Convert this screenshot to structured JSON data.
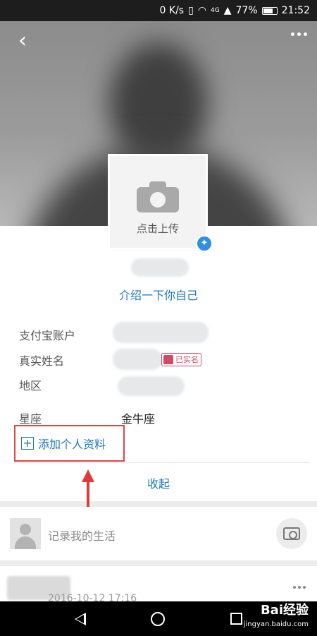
{
  "status_bar": {
    "speed": "0 K/s",
    "network": "4G",
    "battery": "77%",
    "time": "21:52",
    "battery_level": 0.77
  },
  "profile": {
    "upload_label": "点击上传",
    "intro_link": "介绍一下你自己",
    "fields": [
      {
        "label": "支付宝账户"
      },
      {
        "label": "真实姓名",
        "badge": "已实名"
      },
      {
        "label": "地区"
      },
      {
        "label": "星座",
        "value": "金牛座"
      }
    ],
    "add_profile_label": "添加个人资料",
    "collapse_label": "收起"
  },
  "life": {
    "placeholder": "记录我的生活"
  },
  "post": {
    "date": "2016-10-12 17:16"
  },
  "watermark": {
    "brand": "Bai经验",
    "url": "jingyan.baidu.com"
  },
  "colors": {
    "accent": "#1f78b4",
    "highlight_box": "#e04646",
    "realname_badge": "#d14a66"
  }
}
